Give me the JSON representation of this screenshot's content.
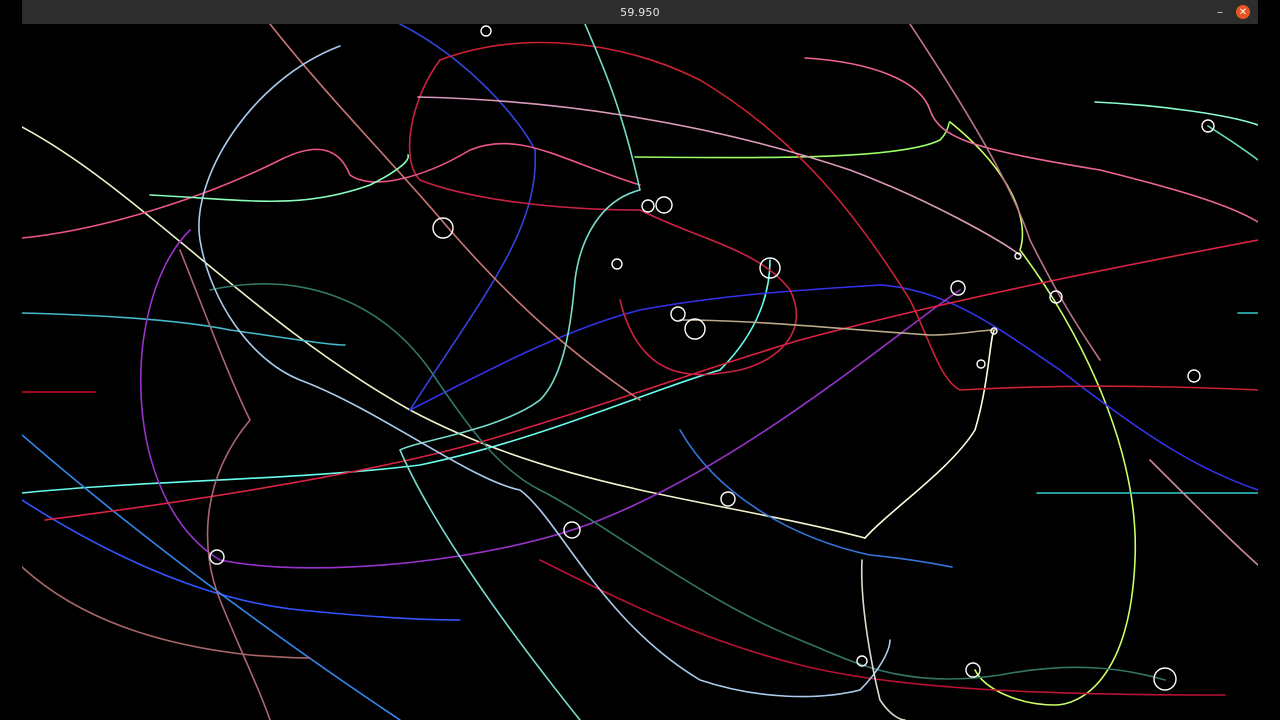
{
  "window": {
    "title": "59.950",
    "minimize_label": "–",
    "close_label": "✕"
  },
  "colors": {
    "titlebar": "#2d2d2d",
    "close_button": "#e95420",
    "canvas": "#000000"
  },
  "icons": {
    "minimize": "minimize-icon",
    "close": "close-icon"
  }
}
